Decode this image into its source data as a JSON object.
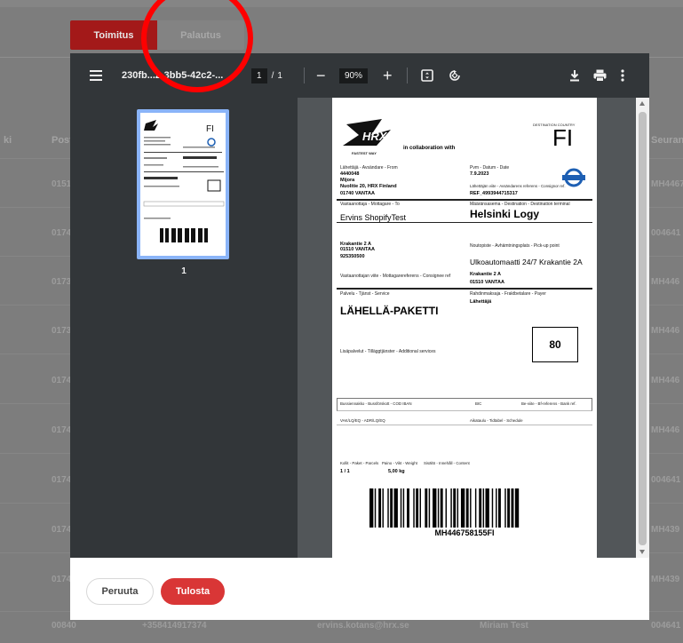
{
  "tabs": [
    {
      "label": "Toimitus"
    },
    {
      "label": "Palautus"
    }
  ],
  "background": {
    "headers": [
      "ki",
      "Post",
      "Seurant"
    ],
    "rows": [
      {
        "post": "0151",
        "track": "MH4467"
      },
      {
        "post": "0174",
        "track": "004641"
      },
      {
        "post": "0173",
        "track": "MH446"
      },
      {
        "post": "0173",
        "track": "MH446"
      },
      {
        "post": "0174",
        "track": "MH446"
      },
      {
        "post": "0174",
        "track": "MH446"
      },
      {
        "post": "0174",
        "track": "004641"
      },
      {
        "post": "0174",
        "track": "MH439"
      },
      {
        "post": "0174",
        "track": "MH439"
      }
    ],
    "last_row": {
      "post": "00840",
      "phone": "+358414917374",
      "email": "ervins.kotans@hrx.se",
      "name": "Miriam Test",
      "track": "004641"
    }
  },
  "viewer": {
    "filename": "230fb...2-3bb5-42c2-...",
    "page_current": "1",
    "page_sep": "/",
    "page_total": "1",
    "zoom": "90%",
    "thumb_page_number": "1"
  },
  "label": {
    "brand_tagline": "FASTEST WAY",
    "collab": "in collaboration with",
    "dest_country_label": "DESTINATION COUNTRY",
    "dest_country": "FI",
    "sender_label": "Lähettäjä - Avsändare - From",
    "sender_id": "4440048",
    "sender_name": "Mijora",
    "sender_address": "Nuolitie 20, HRX Finland",
    "sender_city": "01740 VANTAA",
    "date_label": "Pvm - Datum - Date",
    "date": "7.9.2023",
    "sender_ref_label": "Lähettäjän viite - Avsändarens referens - Consignor ref.",
    "sender_ref": "REF_4993944715317",
    "receiver_label": "Vastaanottaja - Mottagare - To",
    "receiver_name": "Ervins ShopifyTest",
    "receiver_street": "Krakantie 2 A",
    "receiver_city": "01510 VANTAA",
    "receiver_phone": "925350500",
    "receiver_ref_label": "Vastaanottajan viite - Mottagarereferens - Consignee ref",
    "dest_terminal_label": "Määränsasema - Destination - Destination terminal",
    "dest_terminal": "Helsinki Logy",
    "pickup_label": "Noutopiste - Avhämtningsplats - Pick-up point",
    "pickup_name": "Ulkoautomaatti 24/7 Krakantie 2A",
    "pickup_street": "Krakantie 2 A",
    "pickup_city": "01510 VANTAA",
    "service_label": "Palvelu - Tjänst - Service",
    "service": "LÄHELLÄ-PAKETTI",
    "payer_label": "Rahdinmaksaja - Fraktbetalare - Payer",
    "payer": "Lähettäjä",
    "route_code": "80",
    "additional_label": "Lisäpalvelut - Tilläggtjänster - Additional services",
    "cod_label": "Bussiennakko - Bussförskott - COD IBAN",
    "bic_label": "BIC",
    "bank_ref_label": "Be-viite - Bf-referens - Bank ref.",
    "adr_label": "VAK/LQ/EQ - ADR/LQ/EQ",
    "schedule_label": "Aikataulu - Tidtabel - Schedule",
    "parcels_label": "Kollit - Paket - Parcels",
    "weight_label": "Paino - Vikt - Weight",
    "content_label": "Sisältö - Innehåll - Content",
    "parcels": "1 / 1",
    "weight": "5,00 kg",
    "barcode_text": "MH446758155FI"
  },
  "footer": {
    "cancel": "Peruuta",
    "print": "Tulosta"
  },
  "colors": {
    "accent": "#d93636",
    "annotation": "#ff0000"
  }
}
